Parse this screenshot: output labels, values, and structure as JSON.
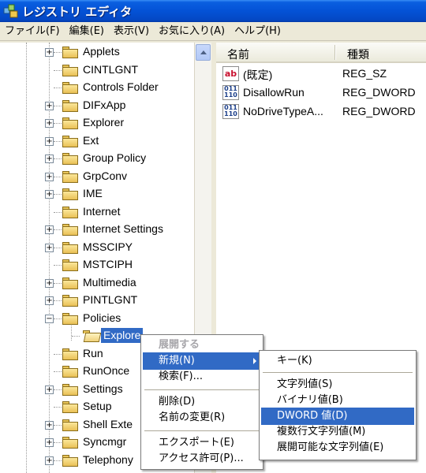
{
  "window": {
    "title": "レジストリ エディタ"
  },
  "menubar": [
    "ファイル(F)",
    "編集(E)",
    "表示(V)",
    "お気に入り(A)",
    "ヘルプ(H)"
  ],
  "tree": {
    "items": [
      {
        "label": "Applets",
        "expander": "+"
      },
      {
        "label": "CINTLGNT",
        "expander": ""
      },
      {
        "label": "Controls Folder",
        "expander": ""
      },
      {
        "label": "DIFxApp",
        "expander": "+"
      },
      {
        "label": "Explorer",
        "expander": "+"
      },
      {
        "label": "Ext",
        "expander": "+"
      },
      {
        "label": "Group Policy",
        "expander": "+"
      },
      {
        "label": "GrpConv",
        "expander": "+"
      },
      {
        "label": "IME",
        "expander": "+"
      },
      {
        "label": "Internet",
        "expander": ""
      },
      {
        "label": "Internet Settings",
        "expander": "+"
      },
      {
        "label": "MSSCIPY",
        "expander": "+"
      },
      {
        "label": "MSTCIPH",
        "expander": ""
      },
      {
        "label": "Multimedia",
        "expander": "+"
      },
      {
        "label": "PINTLGNT",
        "expander": "+"
      },
      {
        "label": "Policies",
        "expander": "−"
      },
      {
        "label": "",
        "expander": ""
      },
      {
        "label": "Run",
        "expander": ""
      },
      {
        "label": "RunOnce",
        "expander": ""
      },
      {
        "label": "Settings",
        "expander": "+"
      },
      {
        "label": "Setup",
        "expander": ""
      },
      {
        "label": "Shell Exte",
        "expander": "+"
      },
      {
        "label": "Syncmgr",
        "expander": "+"
      },
      {
        "label": "Telephony",
        "expander": "+"
      }
    ],
    "selected_label": "Explore"
  },
  "list": {
    "columns": {
      "name": "名前",
      "type": "種類"
    },
    "rows": [
      {
        "name": "(既定)",
        "type": "REG_SZ",
        "icon": "string-value-icon",
        "glyph": "ab"
      },
      {
        "name": "DisallowRun",
        "type": "REG_DWORD",
        "icon": "binary-value-icon",
        "glyph": "011 110"
      },
      {
        "name": "NoDriveTypeA...",
        "type": "REG_DWORD",
        "icon": "binary-value-icon",
        "glyph": "011 110"
      }
    ]
  },
  "context_menu": {
    "items": [
      "展開する",
      "新規(N)",
      "検索(F)...",
      "削除(D)",
      "名前の変更(R)",
      "エクスポート(E)",
      "アクセス許可(P)..."
    ]
  },
  "submenu": {
    "items": [
      "キー(K)",
      "文字列値(S)",
      "バイナリ値(B)",
      "DWORD 値(D)",
      "複数行文字列値(M)",
      "展開可能な文字列値(E)"
    ]
  },
  "colors": {
    "selection": "#316ac5",
    "titlebar": "#0452d6",
    "chrome": "#ece9d8"
  }
}
